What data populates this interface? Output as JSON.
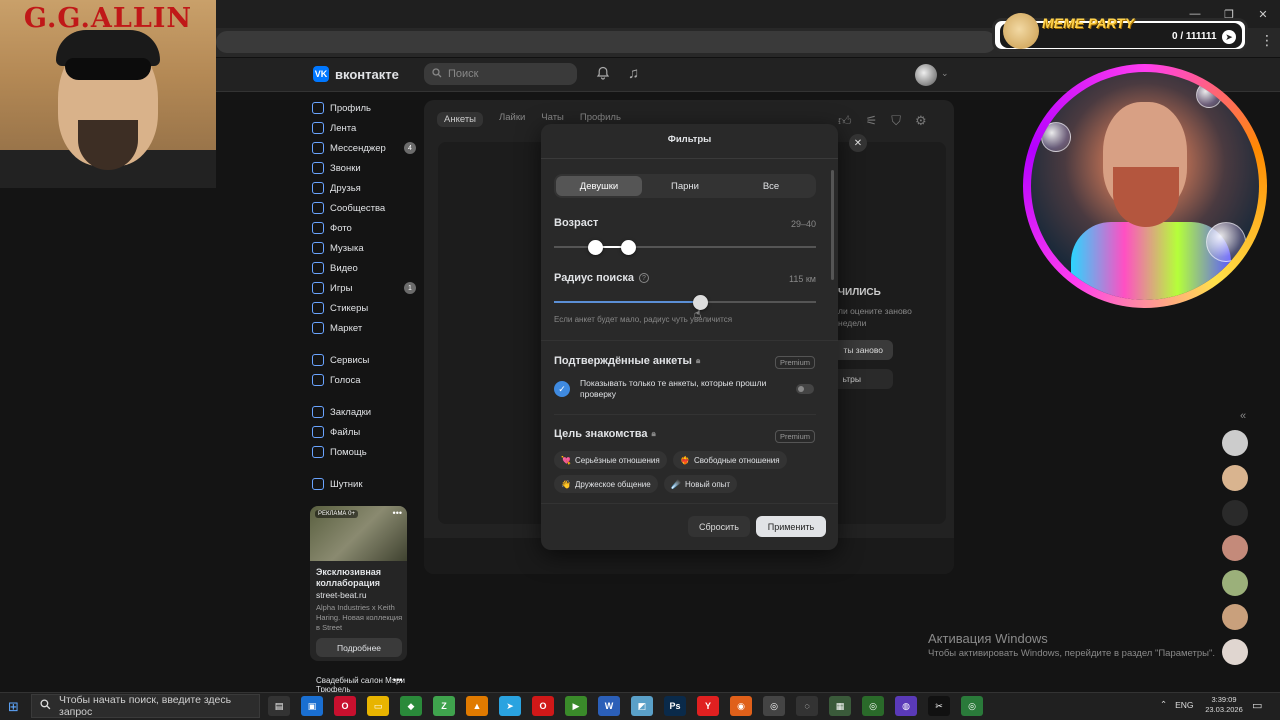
{
  "overlay": {
    "poster_title": "G.G.ALLIN",
    "meme_title": "MEME PARTY",
    "meme_counter": "0 / 111111"
  },
  "header": {
    "logo_text": "вконтакте",
    "logo_mark": "VK",
    "search_placeholder": "Поиск"
  },
  "sidebar": {
    "items": [
      {
        "label": "Профиль",
        "icon": "profile-icon"
      },
      {
        "label": "Лента",
        "icon": "feed-icon"
      },
      {
        "label": "Мессенджер",
        "icon": "messenger-icon",
        "badge": "4"
      },
      {
        "label": "Звонки",
        "icon": "phone-icon"
      },
      {
        "label": "Друзья",
        "icon": "friends-icon"
      },
      {
        "label": "Сообщества",
        "icon": "communities-icon"
      },
      {
        "label": "Фото",
        "icon": "photo-icon"
      },
      {
        "label": "Музыка",
        "icon": "music-icon"
      },
      {
        "label": "Видео",
        "icon": "video-icon"
      },
      {
        "label": "Игры",
        "icon": "games-icon",
        "badge": "1"
      },
      {
        "label": "Стикеры",
        "icon": "stickers-icon"
      },
      {
        "label": "Маркет",
        "icon": "market-icon"
      }
    ],
    "items2": [
      {
        "label": "Сервисы",
        "icon": "services-icon"
      },
      {
        "label": "Голоса",
        "icon": "votes-icon"
      }
    ],
    "items3": [
      {
        "label": "Закладки",
        "icon": "bookmarks-icon"
      },
      {
        "label": "Файлы",
        "icon": "files-icon"
      },
      {
        "label": "Помощь",
        "icon": "help-icon"
      }
    ],
    "items4": [
      {
        "label": "Шутник",
        "icon": "joker-icon"
      }
    ]
  },
  "ad": {
    "label": "РЕКЛАМА 0+",
    "title": "Эксклюзивная коллаборация",
    "domain": "street-beat.ru",
    "description": "Alpha Industries x Keith Haring. Новая коллекция в Street",
    "button": "Подробнее",
    "next_title": "Свадебный салон Мэри Трюфель"
  },
  "main": {
    "tabs": [
      "Анкеты",
      "Лайки",
      "Чаты",
      "Профиль"
    ],
    "bg_title": "ЧИЛИСЬ",
    "bg_sub": "ли оцените заново недели",
    "bg_btn1": "ты заново",
    "bg_btn2": "ьтры"
  },
  "modal": {
    "title": "Фильтры",
    "segments": [
      "Девушки",
      "Парни",
      "Все"
    ],
    "selected_segment": "Девушки",
    "age_title": "Возраст",
    "age_value": "29–40",
    "age_min": 29,
    "age_max": 40,
    "radius_title": "Радиус поиска",
    "radius_value": "115 км",
    "radius_hint": "Если анкет будет мало, радиус чуть увеличится",
    "verified_title": "Подтверждённые анкеты",
    "verified_premium": "Premium",
    "verified_text": "Показывать только те анкеты, которые прошли проверку",
    "goal_title": "Цель знакомства",
    "goal_premium": "Premium",
    "goals": [
      {
        "emoji": "💘",
        "label": "Серьёзные отношения"
      },
      {
        "emoji": "❤️‍🔥",
        "label": "Свободные отношения"
      },
      {
        "emoji": "👋",
        "label": "Дружеское общение"
      },
      {
        "emoji": "☄️",
        "label": "Новый опыт"
      }
    ],
    "reset": "Сбросить",
    "apply": "Применить"
  },
  "watermark": {
    "title": "Активация Windows",
    "subtitle": "Чтобы активировать Windows, перейдите в раздел \"Параметры\"."
  },
  "taskbar": {
    "search_placeholder": "Чтобы начать поиск, введите здесь запрос",
    "lang": "ENG",
    "time": "3:39:09",
    "date": "23.03.2026"
  },
  "colors": {
    "accent": "#0077ff",
    "check": "#3f8ae0",
    "slider_fill": "#5b8fd6"
  }
}
